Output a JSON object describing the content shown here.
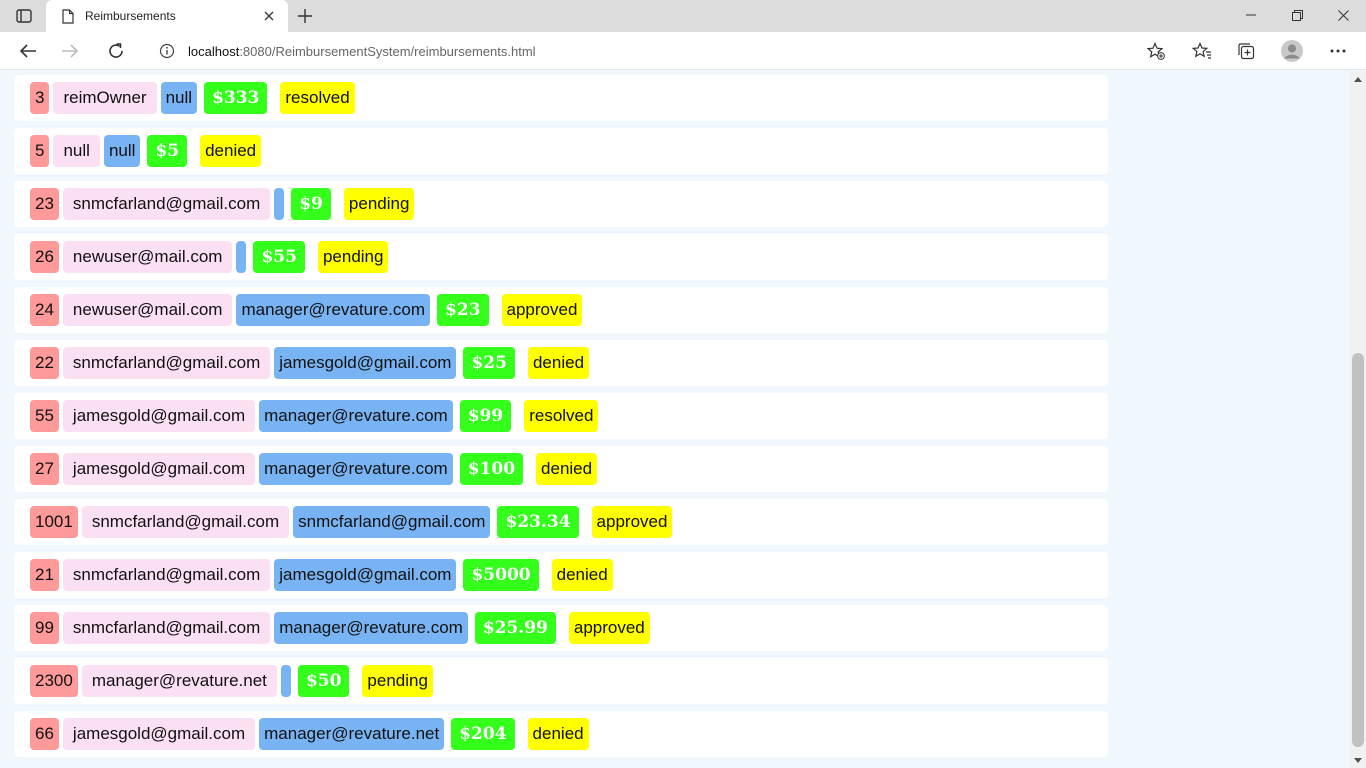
{
  "browser": {
    "tab_title": "Reimbursements",
    "url_host": "localhost",
    "url_rest": ":8080/ReimbursementSystem/reimbursements.html"
  },
  "reimbursements": [
    {
      "id": "3",
      "owner": "reimOwner",
      "resolver": "null",
      "amount": "$333",
      "status": "resolved"
    },
    {
      "id": "5",
      "owner": "null",
      "resolver": "null",
      "amount": "$5",
      "status": "denied"
    },
    {
      "id": "23",
      "owner": "snmcfarland@gmail.com",
      "resolver": "",
      "amount": "$9",
      "status": "pending"
    },
    {
      "id": "26",
      "owner": "newuser@mail.com",
      "resolver": "",
      "amount": "$55",
      "status": "pending"
    },
    {
      "id": "24",
      "owner": "newuser@mail.com",
      "resolver": "manager@revature.com",
      "amount": "$23",
      "status": "approved"
    },
    {
      "id": "22",
      "owner": "snmcfarland@gmail.com",
      "resolver": "jamesgold@gmail.com",
      "amount": "$25",
      "status": "denied"
    },
    {
      "id": "55",
      "owner": "jamesgold@gmail.com",
      "resolver": "manager@revature.com",
      "amount": "$99",
      "status": "resolved"
    },
    {
      "id": "27",
      "owner": "jamesgold@gmail.com",
      "resolver": "manager@revature.com",
      "amount": "$100",
      "status": "denied"
    },
    {
      "id": "1001",
      "owner": "snmcfarland@gmail.com",
      "resolver": "snmcfarland@gmail.com",
      "amount": "$23.34",
      "status": "approved"
    },
    {
      "id": "21",
      "owner": "snmcfarland@gmail.com",
      "resolver": "jamesgold@gmail.com",
      "amount": "$5000",
      "status": "denied"
    },
    {
      "id": "99",
      "owner": "snmcfarland@gmail.com",
      "resolver": "manager@revature.com",
      "amount": "$25.99",
      "status": "approved"
    },
    {
      "id": "2300",
      "owner": "manager@revature.net",
      "resolver": "",
      "amount": "$50",
      "status": "pending"
    },
    {
      "id": "66",
      "owner": "jamesgold@gmail.com",
      "resolver": "manager@revature.net",
      "amount": "$204",
      "status": "denied"
    }
  ],
  "colors": {
    "id_chip": "#ff9a9a",
    "owner_chip": "#fbdff3",
    "resolver_chip": "#78b4f3",
    "amount_chip": "#33ff1a",
    "status_chip": "#ffff00",
    "page_background": "#f0f7ff"
  }
}
